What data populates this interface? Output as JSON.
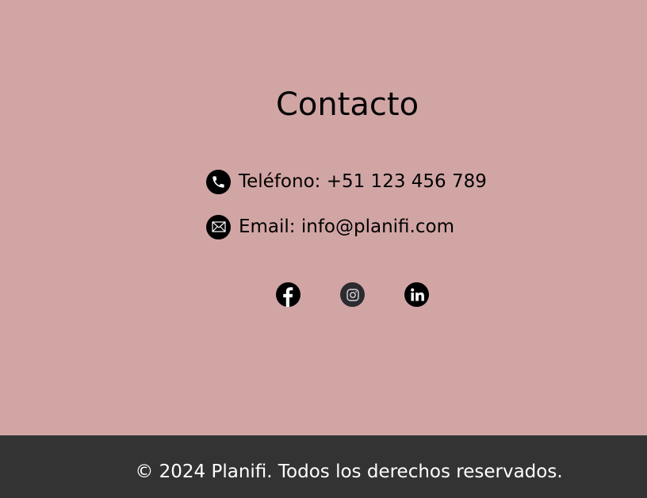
{
  "contact": {
    "title": "Contacto",
    "phone_text": "Teléfono: +51 123 456 789",
    "email_text": "Email: info@planifi.com"
  },
  "social": {
    "items": [
      {
        "icon": "facebook-icon"
      },
      {
        "icon": "instagram-icon"
      },
      {
        "icon": "linkedin-icon"
      }
    ]
  },
  "footer": {
    "copyright": "© 2024 Planifi. Todos los derechos reservados."
  },
  "colors": {
    "section_background": "#d2a5a5",
    "footer_background": "#333333",
    "footer_text": "#ffffff"
  }
}
